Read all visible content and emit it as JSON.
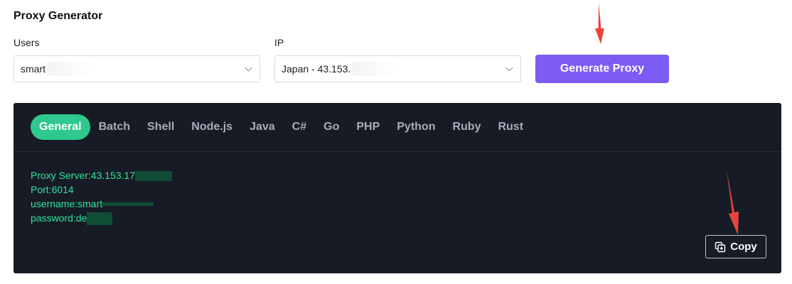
{
  "page": {
    "title": "Proxy Generator"
  },
  "users": {
    "label": "Users",
    "value": "smart"
  },
  "ip": {
    "label": "IP",
    "value": "Japan - 43.153."
  },
  "generate_button": {
    "label": "Generate Proxy"
  },
  "tabs": [
    {
      "label": "General",
      "active": true
    },
    {
      "label": "Batch"
    },
    {
      "label": "Shell"
    },
    {
      "label": "Node.js"
    },
    {
      "label": "Java"
    },
    {
      "label": "C#"
    },
    {
      "label": "Go"
    },
    {
      "label": "PHP"
    },
    {
      "label": "Python"
    },
    {
      "label": "Ruby"
    },
    {
      "label": "Rust"
    }
  ],
  "output": {
    "server": "Proxy Server:43.153.17",
    "port": "Port:6014",
    "username": "username:smart",
    "password": "password:de"
  },
  "copy_button": {
    "label": "Copy"
  },
  "colors": {
    "accent_purple": "#7c5cf5",
    "tab_active": "#2fc98e",
    "code_green": "#2ee59d",
    "panel_bg": "#171b26",
    "arrow_red": "#e8453c"
  }
}
